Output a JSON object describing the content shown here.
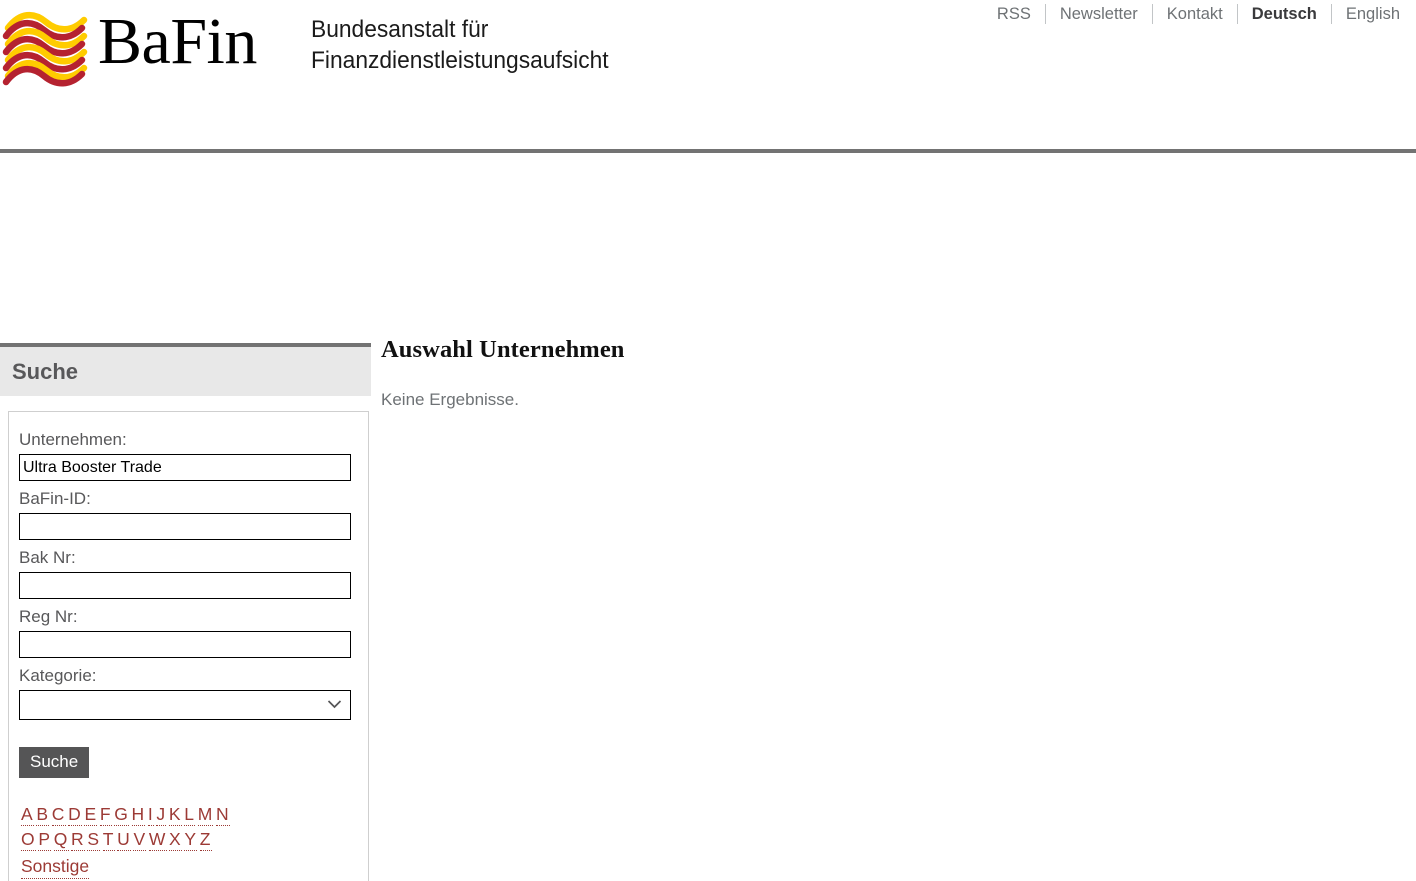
{
  "header": {
    "logo_alt": "BaFin wave logo",
    "wordmark": "BaFin",
    "subtitle_line1": "Bundesanstalt für",
    "subtitle_line2": "Finanzdienstleistungsaufsicht",
    "colors": {
      "logo_red": "#b52230",
      "logo_yellow": "#ffcc00",
      "rule": "#737373"
    },
    "topnav": [
      {
        "label": "RSS",
        "active": false
      },
      {
        "label": "Newsletter",
        "active": false
      },
      {
        "label": "Kontakt",
        "active": false
      },
      {
        "label": "Deutsch",
        "active": true
      },
      {
        "label": "English",
        "active": false
      }
    ]
  },
  "sidebar": {
    "title": "Suche",
    "fields": [
      {
        "label": "Unternehmen:",
        "value": "Ultra Booster Trade",
        "placeholder": ""
      },
      {
        "label": "BaFin-ID:",
        "value": "",
        "placeholder": ""
      },
      {
        "label": "Bak Nr:",
        "value": "",
        "placeholder": ""
      },
      {
        "label": "Reg Nr:",
        "value": "",
        "placeholder": ""
      }
    ],
    "category": {
      "label": "Kategorie:",
      "selected": "",
      "options": [
        ""
      ]
    },
    "submit_label": "Suche",
    "alphabet_row1": [
      "A",
      "B",
      "C",
      "D",
      "E",
      "F",
      "G",
      "H",
      "I",
      "J",
      "K",
      "L",
      "M",
      "N"
    ],
    "alphabet_row2": [
      "O",
      "P",
      "Q",
      "R",
      "S",
      "T",
      "U",
      "V",
      "W",
      "X",
      "Y",
      "Z"
    ],
    "other_label": "Sonstige",
    "link_color": "#9c3a35"
  },
  "main": {
    "title": "Auswahl Unternehmen",
    "message": "Keine Ergebnisse."
  }
}
